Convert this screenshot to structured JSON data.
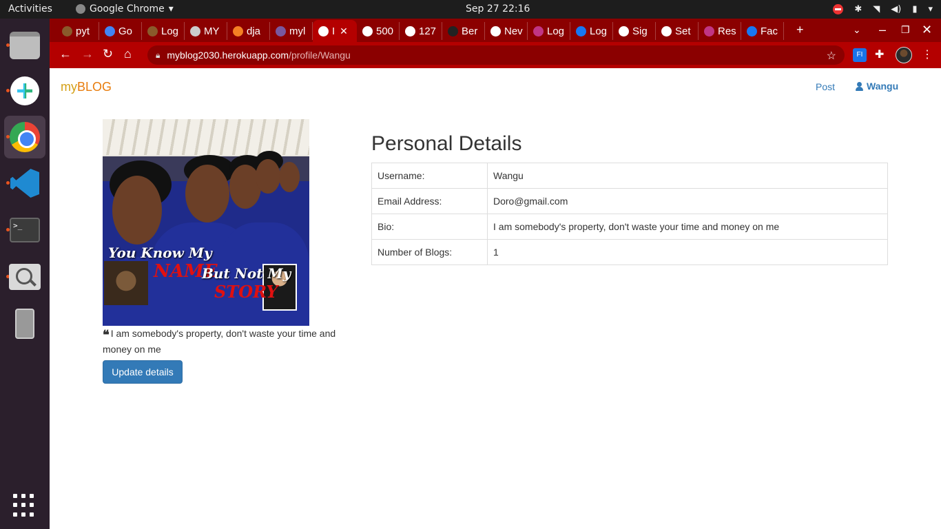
{
  "os": {
    "activities": "Activities",
    "app_name": "Google Chrome",
    "clock": "Sep 27  22:16"
  },
  "browser": {
    "tabs": [
      {
        "label": "pyt",
        "favicon": "palm-icon",
        "color": "#8a5a2b"
      },
      {
        "label": "Go",
        "favicon": "docs-icon",
        "color": "#4285f4"
      },
      {
        "label": "Log",
        "favicon": "palm-icon",
        "color": "#8a5a2b"
      },
      {
        "label": "MY",
        "favicon": "globe-icon",
        "color": "#cccccc"
      },
      {
        "label": "dja",
        "favicon": "stackoverflow-icon",
        "color": "#f48024"
      },
      {
        "label": "myl",
        "favicon": "heroku-icon",
        "color": "#79589f"
      },
      {
        "label": "I",
        "favicon": "globe-icon",
        "color": "#ffffff",
        "active": true
      },
      {
        "label": "500",
        "favicon": "globe-icon",
        "color": "#ffffff"
      },
      {
        "label": "127",
        "favicon": "globe-icon",
        "color": "#ffffff"
      },
      {
        "label": "Ber",
        "favicon": "github-icon",
        "color": "#222222"
      },
      {
        "label": "Nev",
        "favicon": "chrome-icon",
        "color": "#ffffff"
      },
      {
        "label": "Log",
        "favicon": "instagram-icon",
        "color": "#c13584"
      },
      {
        "label": "Log",
        "favicon": "facebook-icon",
        "color": "#1877f2"
      },
      {
        "label": "Sig",
        "favicon": "google-icon",
        "color": "#ffffff"
      },
      {
        "label": "Set",
        "favicon": "gear-icon",
        "color": "#ffffff"
      },
      {
        "label": "Res",
        "favicon": "instagram-icon",
        "color": "#c13584"
      },
      {
        "label": "Fac",
        "favicon": "facebook-icon",
        "color": "#1877f2"
      }
    ],
    "url_host": "myblog2030.herokuapp.com",
    "url_path": "/profile/Wangu",
    "ext_label": "FI"
  },
  "site": {
    "brand_my": "my",
    "brand_blog": "BLOG",
    "nav_post": "Post",
    "nav_user": "Wangu"
  },
  "profile": {
    "photo_caption_1": "You Know My",
    "photo_caption_2": "NAME",
    "photo_caption_3": "But Not My",
    "photo_caption_4": "STORY",
    "quote": "I am somebody's property, don't waste your time and money on me",
    "update_button": "Update details"
  },
  "details": {
    "title": "Personal Details",
    "rows": [
      {
        "label": "Username:",
        "value": "Wangu"
      },
      {
        "label": "Email Address:",
        "value": "Doro@gmail.com"
      },
      {
        "label": "Bio:",
        "value": "I am somebody's property, don't waste your time and money on me"
      },
      {
        "label": "Number of Blogs:",
        "value": "1"
      }
    ]
  },
  "colors": {
    "tab_strip": "#8b0000",
    "toolbar": "#b40000",
    "link": "#337ab7",
    "button": "#337ab7"
  }
}
